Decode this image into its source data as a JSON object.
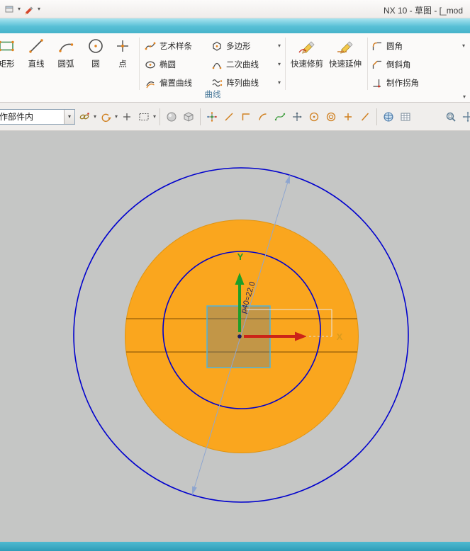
{
  "window": {
    "title": "NX 10 - 草图 - [_mod",
    "qat_icons": [
      "app-menu-icon",
      "dropdown-arrow-icon",
      "sketch-edit-icon",
      "dropdown-arrow-icon"
    ]
  },
  "ribbon": {
    "group_label": "曲线",
    "large_buttons": [
      {
        "label": "矩形",
        "icon": "rectangle-icon"
      },
      {
        "label": "直线",
        "icon": "line-icon"
      },
      {
        "label": "圆弧",
        "icon": "arc-icon"
      },
      {
        "label": "圆",
        "icon": "circle-icon"
      },
      {
        "label": "点",
        "icon": "point-icon"
      }
    ],
    "list_group_1": [
      {
        "label": "艺术样条",
        "icon": "studio-spline-icon"
      },
      {
        "label": "椭圆",
        "icon": "ellipse-icon"
      },
      {
        "label": "偏置曲线",
        "icon": "offset-curve-icon"
      }
    ],
    "list_group_2": [
      {
        "label": "多边形",
        "icon": "polygon-icon",
        "has_dropdown": true
      },
      {
        "label": "二次曲线",
        "icon": "conic-icon",
        "has_dropdown": true
      },
      {
        "label": "阵列曲线",
        "icon": "pattern-curve-icon",
        "has_dropdown": true
      }
    ],
    "medium_buttons": [
      {
        "label": "快速修剪",
        "icon": "quick-trim-icon"
      },
      {
        "label": "快速延伸",
        "icon": "quick-extend-icon"
      }
    ],
    "list_group_3": [
      {
        "label": "圆角",
        "icon": "fillet-icon",
        "has_dropdown": true
      },
      {
        "label": "倒斜角",
        "icon": "chamfer-icon"
      },
      {
        "label": "制作拐角",
        "icon": "make-corner-icon"
      }
    ]
  },
  "toolbar": {
    "scope_value": "作部件内",
    "icons": [
      "link-icon",
      "redo-arrow-icon",
      "plus-icon",
      "marquee-select-icon",
      "sphere-icon",
      "cube-icon",
      "snap-point-icon",
      "slash-line-icon",
      "profile-icon",
      "arc-icon",
      "spline-icon",
      "axis-icon",
      "circle-center-icon",
      "circle-ring-icon",
      "plus-orange-icon",
      "slash-orange-icon",
      "globe-icon",
      "grid-icon",
      "zoom-window-icon",
      "pan-icon"
    ]
  },
  "canvas": {
    "dimension_label": "p40=22.0",
    "axis_x_label": "X",
    "axis_y_label": "Y",
    "colors": {
      "background": "#c5c6c5",
      "disk_fill": "#FAA61E",
      "disk_edge": "#E09410",
      "curve_stroke": "#0000cd",
      "chord_stroke": "#A5690B",
      "square_stroke": "#4FB4DC",
      "x_axis": "#cc2418",
      "y_axis": "#1e9e28",
      "x_label_color": "#DB9C1E",
      "dim_line": "#8FA6CF"
    }
  }
}
